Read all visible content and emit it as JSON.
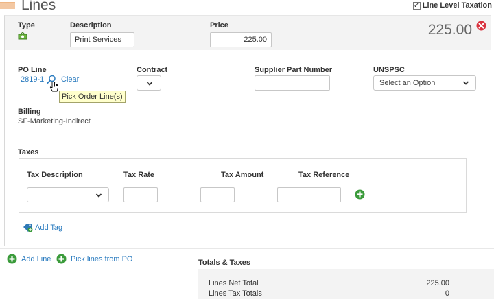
{
  "header": {
    "title": "Lines",
    "line_level_taxation_label": "Line Level Taxation",
    "line_level_taxation_checked": true
  },
  "line": {
    "type_label": "Type",
    "type_icon": "money-icon",
    "description_label": "Description",
    "description_value": "Print Services",
    "price_label": "Price",
    "price_value": "225.00",
    "total_amount": "225.00",
    "po_line_label": "PO Line",
    "po_line_value": "2819-1",
    "clear_label": "Clear",
    "tooltip": "Pick Order Line(s)",
    "contract_label": "Contract",
    "contract_value": "",
    "supplier_part_label": "Supplier Part Number",
    "supplier_part_value": "",
    "unspsc_label": "UNSPSC",
    "unspsc_value": "Select an Option",
    "billing_label": "Billing",
    "billing_value": "SF-Marketing-Indirect"
  },
  "taxes": {
    "section_label": "Taxes",
    "headers": {
      "description": "Tax Description",
      "rate": "Tax Rate",
      "amount": "Tax Amount",
      "reference": "Tax Reference"
    },
    "row": {
      "description": "",
      "rate": "",
      "amount": "",
      "reference": ""
    }
  },
  "add_tag_label": "Add Tag",
  "footer": {
    "add_line_label": "Add Line",
    "pick_lines_label": "Pick lines from PO",
    "totals_title": "Totals & Taxes",
    "rows": [
      {
        "label": "Lines Net Total",
        "value": "225.00"
      },
      {
        "label": "Lines Tax Totals",
        "value": "0"
      }
    ]
  },
  "colors": {
    "link": "#2a7bbf",
    "green": "#3b9b3b",
    "remove_red": "#d9333f",
    "header_stripe": "#f3c8a3"
  }
}
